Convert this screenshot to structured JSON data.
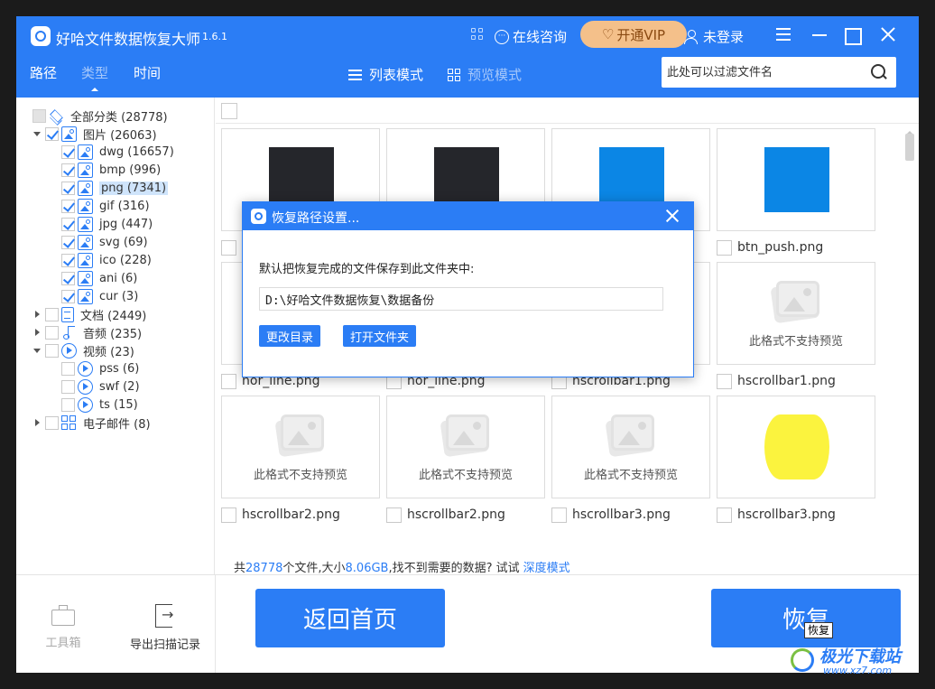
{
  "app": {
    "title": "好哈文件数据恢复大师",
    "version": "1.6.1",
    "consult_label": "在线咨询",
    "vip_label": "开通VIP",
    "login_label": "未登录"
  },
  "nav": {
    "tabs": [
      {
        "label": "路径",
        "active": false
      },
      {
        "label": "类型",
        "active": true
      },
      {
        "label": "时间",
        "active": false
      }
    ],
    "list_mode": "列表模式",
    "preview_mode": "预览模式"
  },
  "search": {
    "placeholder": "此处可以过滤文件名"
  },
  "tree": [
    {
      "label": "全部分类 (28778)",
      "icon": "layers-icon",
      "state": "partial"
    },
    {
      "label": "图片 (26063)",
      "icon": "image-icon",
      "state": "checked"
    },
    {
      "label": "dwg (16657)",
      "icon": "image-icon",
      "state": "checked"
    },
    {
      "label": "bmp (996)",
      "icon": "image-icon",
      "state": "checked"
    },
    {
      "label": "png (7341)",
      "icon": "image-icon",
      "state": "checked",
      "selected": true
    },
    {
      "label": "gif (316)",
      "icon": "image-icon",
      "state": "checked"
    },
    {
      "label": "jpg (447)",
      "icon": "image-icon",
      "state": "checked"
    },
    {
      "label": "svg (69)",
      "icon": "image-icon",
      "state": "checked"
    },
    {
      "label": "ico (228)",
      "icon": "image-icon",
      "state": "checked"
    },
    {
      "label": "ani (6)",
      "icon": "image-icon",
      "state": "checked"
    },
    {
      "label": "cur (3)",
      "icon": "image-icon",
      "state": "checked"
    },
    {
      "label": "文档 (2449)",
      "icon": "document-icon",
      "state": "unchecked"
    },
    {
      "label": "音频 (235)",
      "icon": "music-icon",
      "state": "unchecked"
    },
    {
      "label": "视频 (23)",
      "icon": "video-icon",
      "state": "unchecked"
    },
    {
      "label": "pss (6)",
      "icon": "video-icon",
      "state": "unchecked"
    },
    {
      "label": "swf (2)",
      "icon": "video-icon",
      "state": "unchecked"
    },
    {
      "label": "ts (15)",
      "icon": "video-icon",
      "state": "unchecked"
    },
    {
      "label": "电子邮件 (8)",
      "icon": "email-icon",
      "state": "unchecked"
    }
  ],
  "grid": {
    "no_preview_text": "此格式不支持预览",
    "cards": [
      {
        "thumb": "dark-square",
        "color": "#25262b",
        "name": ""
      },
      {
        "thumb": "dark-square",
        "color": "#25262b",
        "name": ""
      },
      {
        "thumb": "blue-square",
        "color": "#0b86e5",
        "name": ""
      },
      {
        "thumb": "blue-square",
        "color": "#0b86e5",
        "name": "btn_push.png"
      },
      {
        "thumb": "none",
        "name": "hor_line.png"
      },
      {
        "thumb": "none",
        "name": "hor_line.png"
      },
      {
        "thumb": "none",
        "name": "hscrollbar1.png"
      },
      {
        "thumb": "no-preview",
        "name": "hscrollbar1.png"
      },
      {
        "thumb": "no-preview",
        "name": "hscrollbar2.png"
      },
      {
        "thumb": "no-preview",
        "name": "hscrollbar2.png"
      },
      {
        "thumb": "no-preview",
        "name": "hscrollbar3.png"
      },
      {
        "thumb": "yellow-barrel",
        "color": "#fbf33e",
        "name": "hscrollbar3.png"
      }
    ]
  },
  "summary": {
    "prefix": "共",
    "count": "28778",
    "mid": "个文件,大小",
    "size": "8.06GB",
    "suffix": ",找不到需要的数据? 试试",
    "deep_link": "深度模式"
  },
  "bottom": {
    "toolbox_label": "工具箱",
    "export_label": "导出扫描记录",
    "home_button": "返回首页",
    "recover_button": "恢复",
    "tooltip": "恢复"
  },
  "dialog": {
    "title": "恢复路径设置...",
    "label": "默认把恢复完成的文件保存到此文件夹中:",
    "path": "D:\\好哈文件数据恢复\\数据备份",
    "change_dir_button": "更改目录",
    "open_folder_button": "打开文件夹"
  },
  "watermark": {
    "text": "极光下载站",
    "url": "www.xz7.com"
  },
  "colors": {
    "accent": "#2b7df5",
    "vip_bg": "#f4c08a"
  }
}
